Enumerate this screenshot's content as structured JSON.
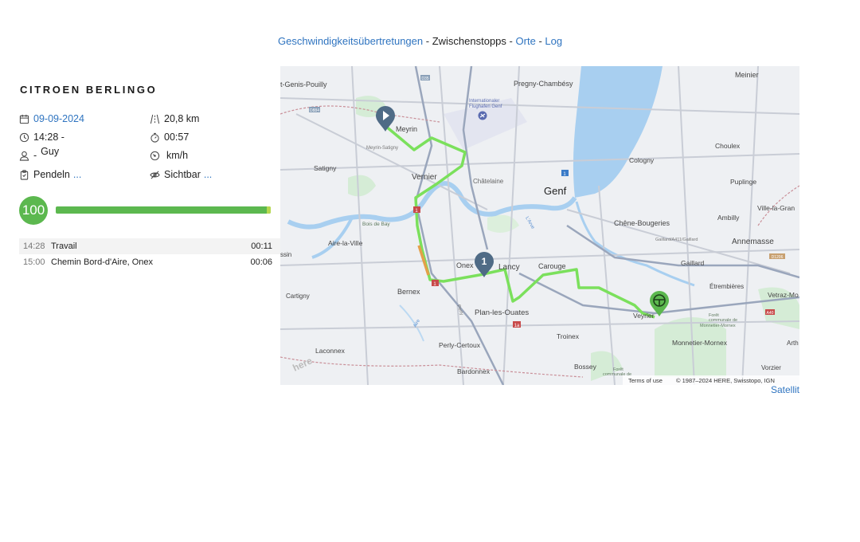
{
  "nav": {
    "speeding": "Geschwindigkeitsübertretungen",
    "stops": "Zwischenstopps",
    "places": "Orte",
    "log": "Log",
    "separator": "-"
  },
  "vehicle": {
    "name": "CITROEN BERLINGO"
  },
  "trip": {
    "date": "09-09-2024",
    "distance": "20,8 km",
    "time_range": "14:28 -",
    "duration": "00:57",
    "driver_prefix": "-",
    "driver": "Guy",
    "speed": "km/h",
    "type": "Pendeln",
    "type_more": "...",
    "visibility": "Sichtbar",
    "visibility_more": "..."
  },
  "score": {
    "value": "100",
    "progress": 1.0
  },
  "stops": [
    {
      "time": "14:28",
      "name": "Travail",
      "duration": "00:11"
    },
    {
      "time": "15:00",
      "name": "Chemin Bord-d'Aire, Onex",
      "duration": "00:06"
    }
  ],
  "map": {
    "labels": {
      "saint_genis": "t-Genis-Pouilly",
      "pregny": "Pregny-Chambésy",
      "meinier": "Meinier",
      "airport_1": "Internationaler",
      "airport_2": "Flughafen Genf",
      "meyrin": "Meyrin",
      "meyrin_satigny": "Meyrin-Satigny",
      "satigny": "Satigny",
      "vernier": "Vernier",
      "chatelaine": "Châtelaine",
      "genf": "Genf",
      "choulex": "Choulex",
      "cologny": "Cologny",
      "puplinge": "Puplinge",
      "bois_de_bay": "Bois de Bay",
      "aire_la_ville": "Aire-la-Ville",
      "chene_bougeries": "Chêne-Bougeries",
      "ambilly": "Ambilly",
      "ville_la_grand": "Ville-la-Gran",
      "annemasse": "Annemasse",
      "gaillard_sign": "Gaillard/A411/Gaillard",
      "gaillard": "Gaillard",
      "onex": "Onex",
      "lancy": "Lancy",
      "carouge": "Carouge",
      "etrembieres": "Étrembières",
      "vetraz": "Vetraz-Mo",
      "cartigny": "Cartigny",
      "bernex": "Bernex",
      "plan_les_ouates": "Plan-les-Ouates",
      "veyrier": "Veyrier",
      "foret_1": "Forêt",
      "foret_2": "communale de",
      "foret_3": "Monnetier-Mornex",
      "monnetier": "Monnetier-Mornex",
      "perly": "Perly-Certoux",
      "laconnex": "Laconnex",
      "troinex": "Troinex",
      "bossey": "Bossey",
      "vorzier": "Vorzier",
      "foret_b1": "Forêt",
      "foret_b2": "communale de",
      "bardonnex": "Bardonnex",
      "arth": "Arth",
      "sin": "ssin",
      "aire_river": "Aire",
      "arve_river": "L'Arve",
      "perly_road": "Perly",
      "here_logo": "here",
      "d35": "D35",
      "d884": "D884",
      "d1206": "D1206",
      "a40": "A40",
      "r1": "1",
      "r1b": "1",
      "r1c": "1",
      "r1a": "1a",
      "r2": "1",
      "stop_marker": "1"
    },
    "terms": "Terms of use",
    "copyright": "© 1987–2024 HERE, Swisstopo, IGN"
  },
  "satellite": "Satellit",
  "colors": {
    "accent": "#2f74c0",
    "score": "#5cb84f",
    "route": "#7be05c",
    "lake": "#a8cff0",
    "marker": "#4f6b86"
  }
}
